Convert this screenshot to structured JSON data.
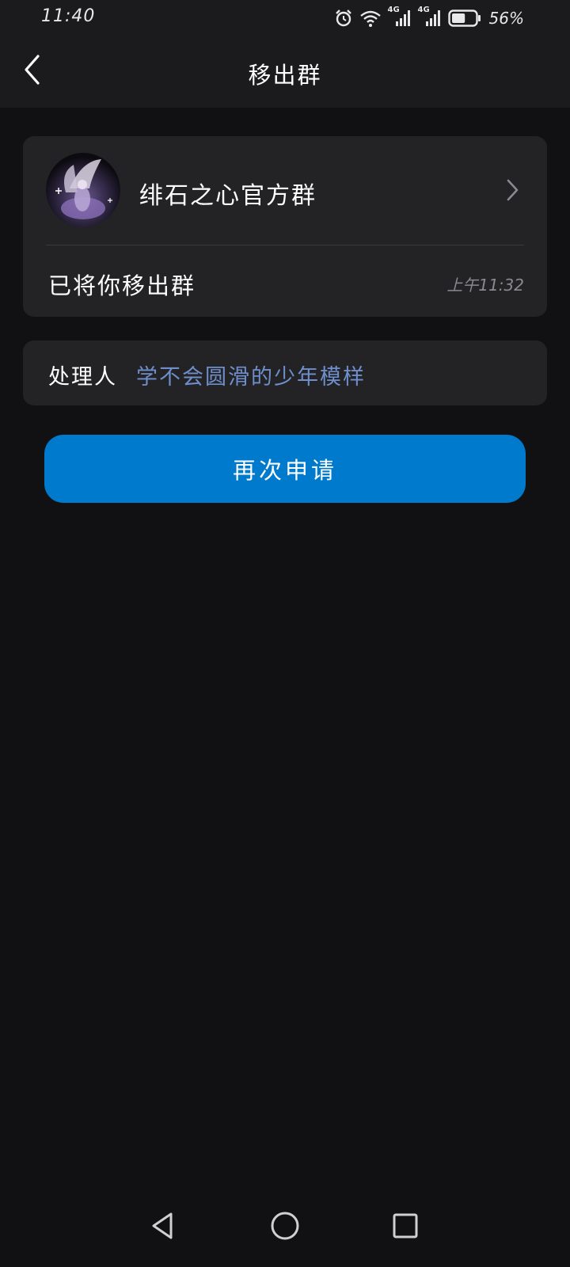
{
  "status_bar": {
    "time": "11:40",
    "battery_percent": "56%",
    "network_1": "4G",
    "network_2": "4G",
    "battery_level": 0.56,
    "icons": [
      "alarm-icon",
      "wifi-icon",
      "signal-icon",
      "signal-icon",
      "battery-icon"
    ]
  },
  "header": {
    "title": "移出群",
    "back_icon": "chevron-left-icon"
  },
  "group_card": {
    "group_name": "绯石之心官方群",
    "message": "已将你移出群",
    "time": "上午11:32",
    "chevron_icon": "chevron-right-icon"
  },
  "handler": {
    "label": "处理人",
    "name": "学不会圆滑的少年模样"
  },
  "actions": {
    "reapply_label": "再次申请"
  },
  "colors": {
    "background": "#111113",
    "card": "#232326",
    "accent_button": "#007acc",
    "handler_link": "#6e8fcc",
    "muted_text": "#8a8a8e"
  },
  "nav_bar": {
    "icons": [
      "back-triangle-icon",
      "home-circle-icon",
      "recents-square-icon"
    ]
  }
}
